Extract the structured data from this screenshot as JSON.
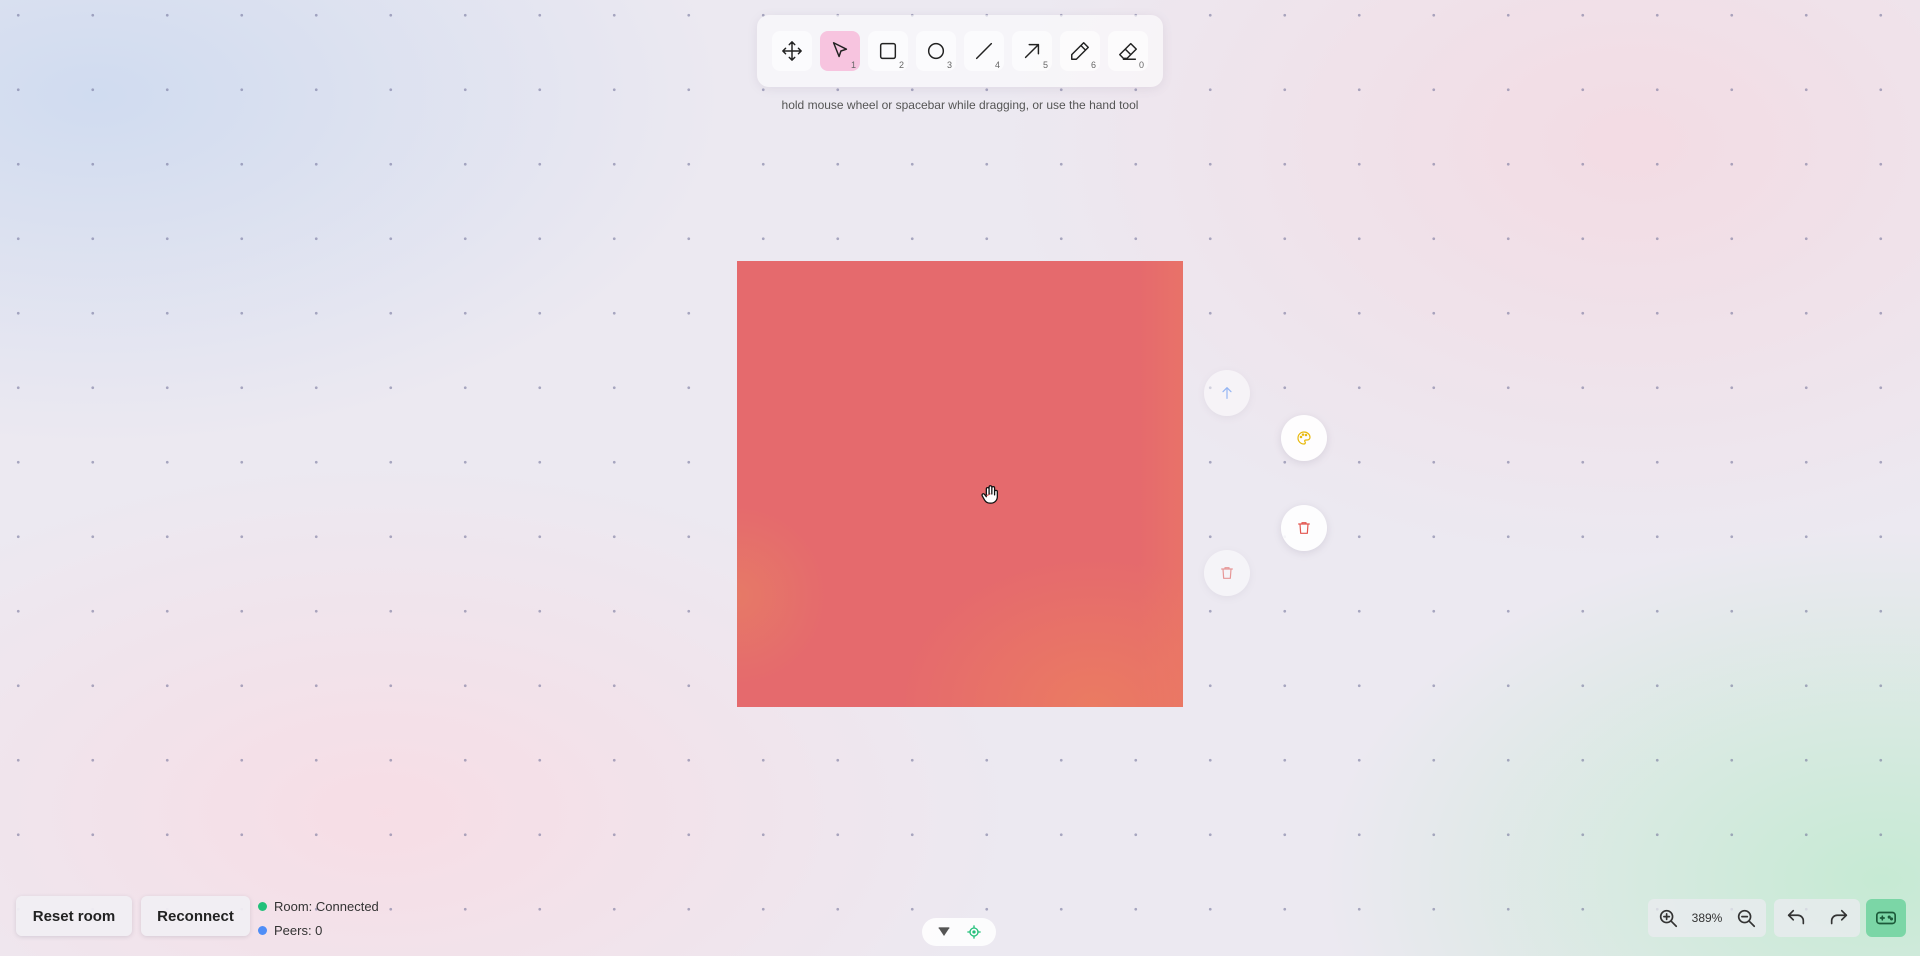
{
  "toolbar": {
    "tools": [
      {
        "name": "hand",
        "icon": "move-icon",
        "key": ""
      },
      {
        "name": "select",
        "icon": "cursor-arrow-icon",
        "key": "1",
        "active": true
      },
      {
        "name": "rectangle",
        "icon": "square-icon",
        "key": "2"
      },
      {
        "name": "ellipse",
        "icon": "circle-icon",
        "key": "3"
      },
      {
        "name": "line",
        "icon": "line-icon",
        "key": "4"
      },
      {
        "name": "arrow",
        "icon": "arrow-icon",
        "key": "5"
      },
      {
        "name": "pencil",
        "icon": "pencil-icon",
        "key": "6"
      },
      {
        "name": "eraser",
        "icon": "eraser-icon",
        "key": "0"
      }
    ],
    "hint": "hold mouse wheel or spacebar while dragging, or use the hand tool"
  },
  "canvas": {
    "shape_color": "#e56a6d",
    "cursor_icon": "hand-grab-icon"
  },
  "actions": {
    "bring_forward_icon": "arrow-up-icon",
    "color_icon": "palette-icon",
    "delete_icon": "trash-icon",
    "ghost_delete_icon": "trash-icon"
  },
  "footer": {
    "reset_label": "Reset room",
    "reconnect_label": "Reconnect",
    "room_status": "Room: Connected",
    "peers": "Peers: 0",
    "room_status_color": "#22c07a",
    "peers_color": "#4f8ef7"
  },
  "zoom": {
    "level": "389%"
  },
  "colors": {
    "active_tool": "#f7c4df",
    "accent_green": "#7bd6a6"
  }
}
